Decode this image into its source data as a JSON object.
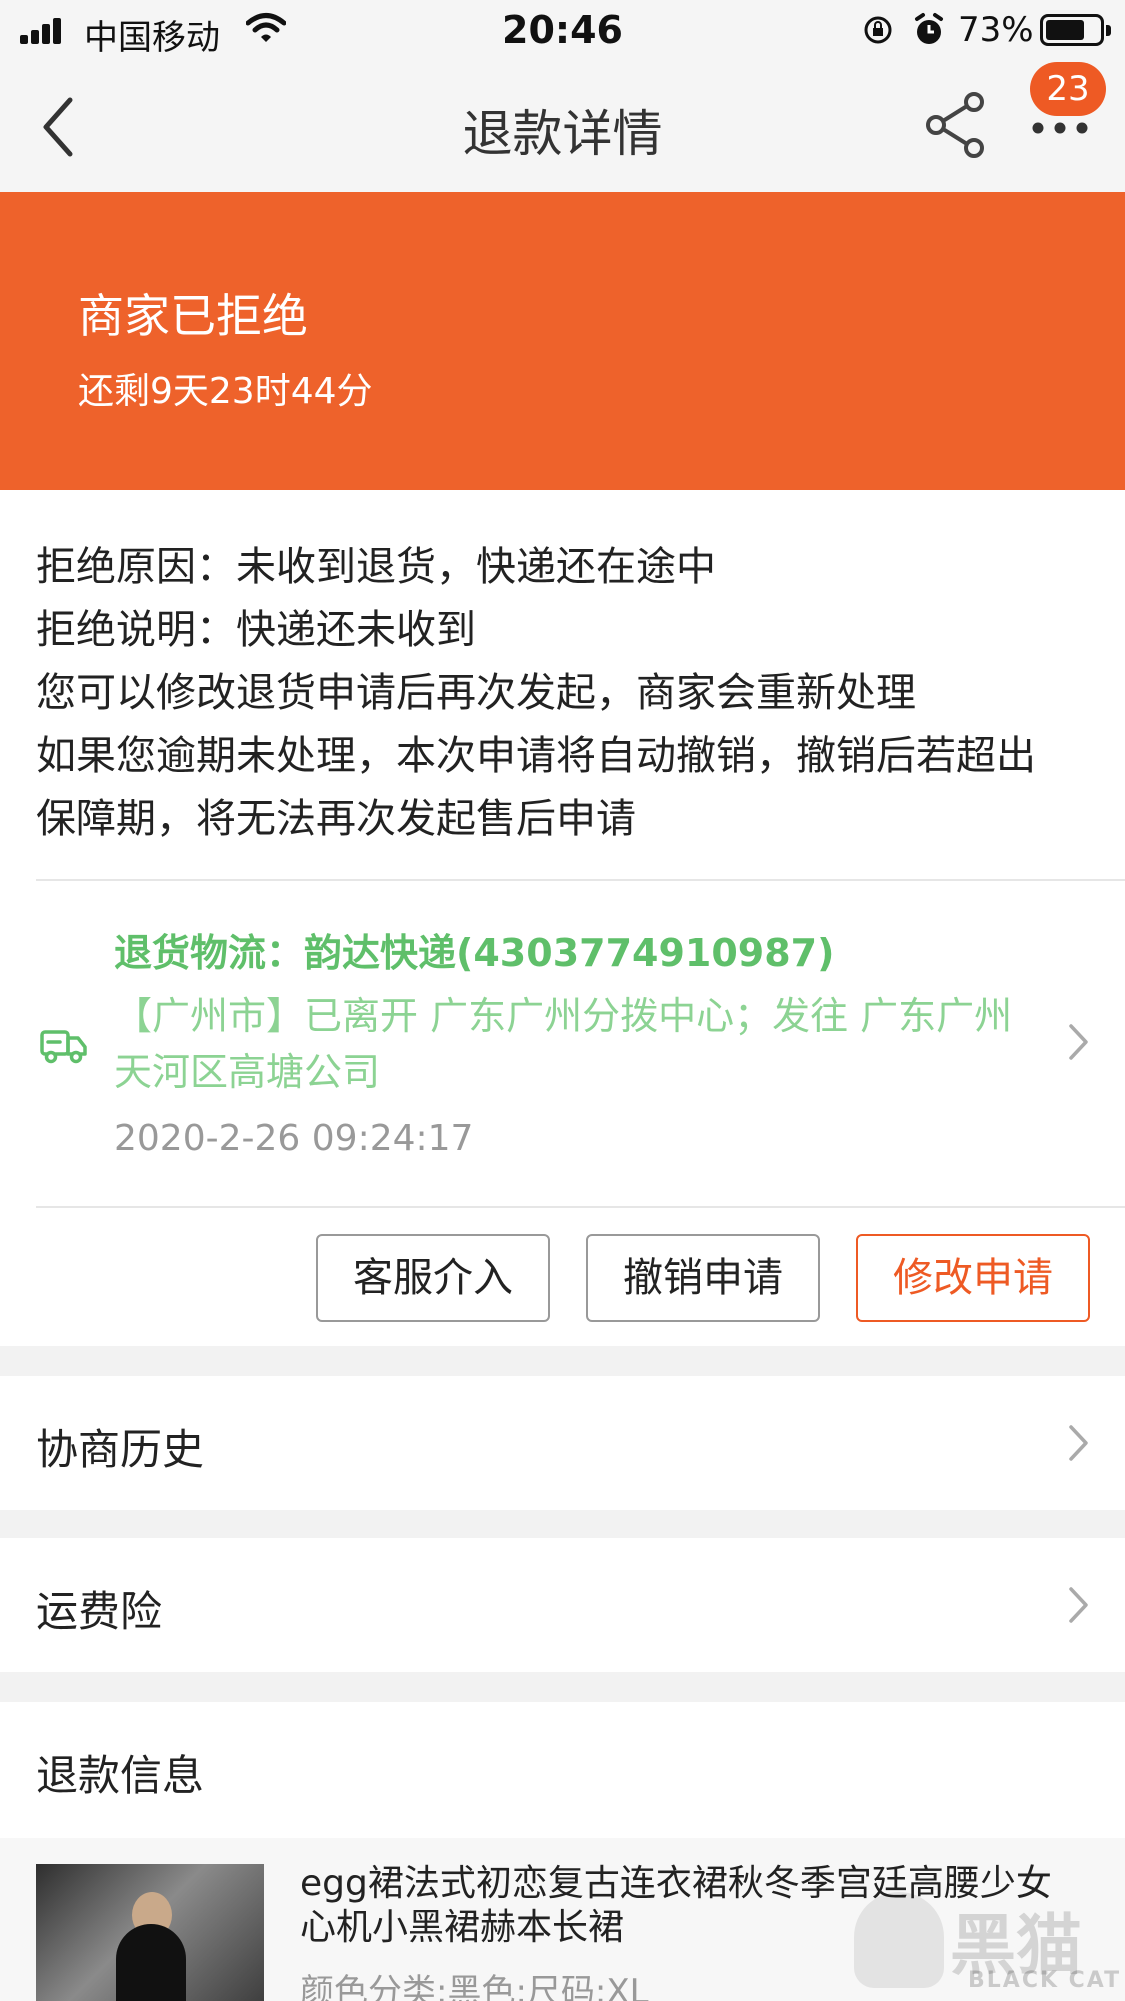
{
  "status_bar": {
    "carrier": "中国移动",
    "time": "20:46",
    "battery": "73%",
    "battery_level": 0.73
  },
  "nav": {
    "title": "退款详情",
    "badge": "23"
  },
  "banner": {
    "title": "商家已拒绝",
    "countdown": "还剩9天23时44分"
  },
  "refusal": {
    "reason": "拒绝原因：未收到退货，快递还在途中",
    "note": "拒绝说明：快递还未收到",
    "hint1": "您可以修改退货申请后再次发起，商家会重新处理",
    "hint2_line1": "如果您逾期未处理，本次申请将自动撤销，撤销后若超出",
    "hint2_line2": "保障期，将无法再次发起售后申请"
  },
  "logistics": {
    "title": "退货物流：韵达快递(4303774910987)",
    "detail": "【广州市】已离开 广东广州分拨中心；发往 广东广州天河区高塘公司",
    "time": "2020-2-26 09:24:17"
  },
  "actions": {
    "service": "客服介入",
    "cancel": "撤销申请",
    "modify": "修改申请"
  },
  "rows": {
    "history": "协商历史",
    "insurance": "运费险"
  },
  "refund_info": {
    "title": "退款信息",
    "product_name": "egg裙法式初恋复古连衣裙秋冬季宫廷高腰少女心机小黑裙赫本长裙",
    "spec": "颜色分类:黑色;尺码:XL"
  },
  "watermark": {
    "text": "黑猫",
    "sub": "BLACK CAT"
  },
  "colors": {
    "accent": "#ee5a24",
    "banner": "#ee622b",
    "logistics_green": "#5fbf6a"
  }
}
